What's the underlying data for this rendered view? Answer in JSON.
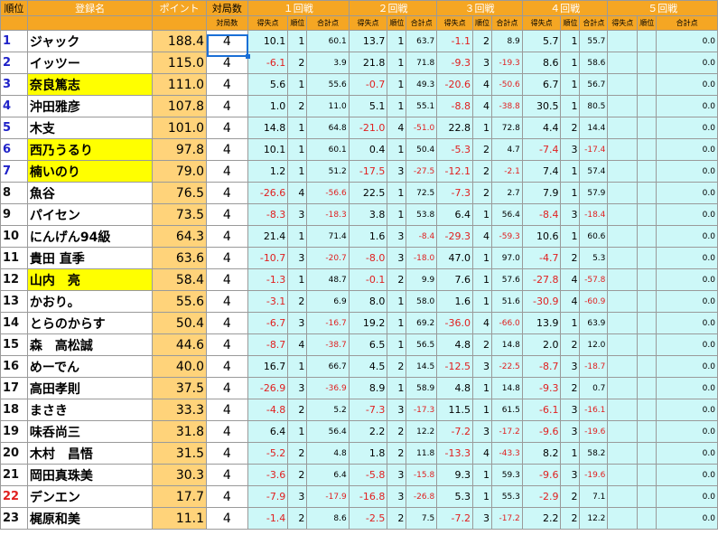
{
  "header": {
    "rank": "順位",
    "name": "登録名",
    "points": "ポイント",
    "games": "対局数",
    "games_sub": "対局数",
    "rounds": [
      "１回戦",
      "２回戦",
      "３回戦",
      "４回戦",
      "５回戦"
    ],
    "sub_score": "得失点",
    "sub_rank": "順位",
    "sub_total": "合計点"
  },
  "rows": [
    {
      "rank": "1",
      "color": "blue",
      "name": "ジャック",
      "hl": false,
      "pts": "188.4",
      "games": "4",
      "r": [
        [
          "10.1",
          "1",
          "60.1"
        ],
        [
          "13.7",
          "1",
          "63.7"
        ],
        [
          "-1.1",
          "2",
          "8.9"
        ],
        [
          "5.7",
          "1",
          "55.7"
        ],
        [
          "",
          "",
          "0.0"
        ]
      ]
    },
    {
      "rank": "2",
      "color": "blue",
      "name": "イッツー",
      "hl": false,
      "pts": "115.0",
      "games": "4",
      "r": [
        [
          "-6.1",
          "2",
          "3.9"
        ],
        [
          "21.8",
          "1",
          "71.8"
        ],
        [
          "-9.3",
          "3",
          "-19.3"
        ],
        [
          "8.6",
          "1",
          "58.6"
        ],
        [
          "",
          "",
          "0.0"
        ]
      ]
    },
    {
      "rank": "3",
      "color": "blue",
      "name": "奈良篤志",
      "hl": true,
      "pts": "111.0",
      "games": "4",
      "r": [
        [
          "5.6",
          "1",
          "55.6"
        ],
        [
          "-0.7",
          "1",
          "49.3"
        ],
        [
          "-20.6",
          "4",
          "-50.6"
        ],
        [
          "6.7",
          "1",
          "56.7"
        ],
        [
          "",
          "",
          "0.0"
        ]
      ]
    },
    {
      "rank": "4",
      "color": "blue",
      "name": "沖田雅彦",
      "hl": false,
      "pts": "107.8",
      "games": "4",
      "r": [
        [
          "1.0",
          "2",
          "11.0"
        ],
        [
          "5.1",
          "1",
          "55.1"
        ],
        [
          "-8.8",
          "4",
          "-38.8"
        ],
        [
          "30.5",
          "1",
          "80.5"
        ],
        [
          "",
          "",
          "0.0"
        ]
      ]
    },
    {
      "rank": "5",
      "color": "blue",
      "name": "木支",
      "hl": false,
      "pts": "101.0",
      "games": "4",
      "r": [
        [
          "14.8",
          "1",
          "64.8"
        ],
        [
          "-21.0",
          "4",
          "-51.0"
        ],
        [
          "22.8",
          "1",
          "72.8"
        ],
        [
          "4.4",
          "2",
          "14.4"
        ],
        [
          "",
          "",
          "0.0"
        ]
      ]
    },
    {
      "rank": "6",
      "color": "blue",
      "name": "西乃うるり",
      "hl": true,
      "pts": "97.8",
      "games": "4",
      "r": [
        [
          "10.1",
          "1",
          "60.1"
        ],
        [
          "0.4",
          "1",
          "50.4"
        ],
        [
          "-5.3",
          "2",
          "4.7"
        ],
        [
          "-7.4",
          "3",
          "-17.4"
        ],
        [
          "",
          "",
          "0.0"
        ]
      ]
    },
    {
      "rank": "7",
      "color": "blue",
      "name": "楠いのり",
      "hl": true,
      "pts": "79.0",
      "games": "4",
      "r": [
        [
          "1.2",
          "1",
          "51.2"
        ],
        [
          "-17.5",
          "3",
          "-27.5"
        ],
        [
          "-12.1",
          "2",
          "-2.1"
        ],
        [
          "7.4",
          "1",
          "57.4"
        ],
        [
          "",
          "",
          "0.0"
        ]
      ]
    },
    {
      "rank": "8",
      "color": "dark",
      "name": "魚谷",
      "hl": false,
      "pts": "76.5",
      "games": "4",
      "r": [
        [
          "-26.6",
          "4",
          "-56.6"
        ],
        [
          "22.5",
          "1",
          "72.5"
        ],
        [
          "-7.3",
          "2",
          "2.7"
        ],
        [
          "7.9",
          "1",
          "57.9"
        ],
        [
          "",
          "",
          "0.0"
        ]
      ]
    },
    {
      "rank": "9",
      "color": "dark",
      "name": "パイセン",
      "hl": false,
      "pts": "73.5",
      "games": "4",
      "r": [
        [
          "-8.3",
          "3",
          "-18.3"
        ],
        [
          "3.8",
          "1",
          "53.8"
        ],
        [
          "6.4",
          "1",
          "56.4"
        ],
        [
          "-8.4",
          "3",
          "-18.4"
        ],
        [
          "",
          "",
          "0.0"
        ]
      ]
    },
    {
      "rank": "10",
      "color": "dark",
      "name": "にんげん94級",
      "hl": false,
      "pts": "64.3",
      "games": "4",
      "r": [
        [
          "21.4",
          "1",
          "71.4"
        ],
        [
          "1.6",
          "3",
          "-8.4"
        ],
        [
          "-29.3",
          "4",
          "-59.3"
        ],
        [
          "10.6",
          "1",
          "60.6"
        ],
        [
          "",
          "",
          "0.0"
        ]
      ]
    },
    {
      "rank": "11",
      "color": "dark",
      "name": "貴田 直季",
      "hl": false,
      "pts": "63.6",
      "games": "4",
      "r": [
        [
          "-10.7",
          "3",
          "-20.7"
        ],
        [
          "-8.0",
          "3",
          "-18.0"
        ],
        [
          "47.0",
          "1",
          "97.0"
        ],
        [
          "-4.7",
          "2",
          "5.3"
        ],
        [
          "",
          "",
          "0.0"
        ]
      ]
    },
    {
      "rank": "12",
      "color": "dark",
      "name": "山内　亮",
      "hl": true,
      "pts": "58.4",
      "games": "4",
      "r": [
        [
          "-1.3",
          "1",
          "48.7"
        ],
        [
          "-0.1",
          "2",
          "9.9"
        ],
        [
          "7.6",
          "1",
          "57.6"
        ],
        [
          "-27.8",
          "4",
          "-57.8"
        ],
        [
          "",
          "",
          "0.0"
        ]
      ]
    },
    {
      "rank": "13",
      "color": "dark",
      "name": "かおり。",
      "hl": false,
      "pts": "55.6",
      "games": "4",
      "r": [
        [
          "-3.1",
          "2",
          "6.9"
        ],
        [
          "8.0",
          "1",
          "58.0"
        ],
        [
          "1.6",
          "1",
          "51.6"
        ],
        [
          "-30.9",
          "4",
          "-60.9"
        ],
        [
          "",
          "",
          "0.0"
        ]
      ]
    },
    {
      "rank": "14",
      "color": "dark",
      "name": "とらのからす",
      "hl": false,
      "pts": "50.4",
      "games": "4",
      "r": [
        [
          "-6.7",
          "3",
          "-16.7"
        ],
        [
          "19.2",
          "1",
          "69.2"
        ],
        [
          "-36.0",
          "4",
          "-66.0"
        ],
        [
          "13.9",
          "1",
          "63.9"
        ],
        [
          "",
          "",
          "0.0"
        ]
      ]
    },
    {
      "rank": "15",
      "color": "dark",
      "name": "森　高松誠",
      "hl": false,
      "pts": "44.6",
      "games": "4",
      "r": [
        [
          "-8.7",
          "4",
          "-38.7"
        ],
        [
          "6.5",
          "1",
          "56.5"
        ],
        [
          "4.8",
          "2",
          "14.8"
        ],
        [
          "2.0",
          "2",
          "12.0"
        ],
        [
          "",
          "",
          "0.0"
        ]
      ]
    },
    {
      "rank": "16",
      "color": "dark",
      "name": "めーでん",
      "hl": false,
      "pts": "40.0",
      "games": "4",
      "r": [
        [
          "16.7",
          "1",
          "66.7"
        ],
        [
          "4.5",
          "2",
          "14.5"
        ],
        [
          "-12.5",
          "3",
          "-22.5"
        ],
        [
          "-8.7",
          "3",
          "-18.7"
        ],
        [
          "",
          "",
          "0.0"
        ]
      ]
    },
    {
      "rank": "17",
      "color": "dark",
      "name": "高田孝則",
      "hl": false,
      "pts": "37.5",
      "games": "4",
      "r": [
        [
          "-26.9",
          "3",
          "-36.9"
        ],
        [
          "8.9",
          "1",
          "58.9"
        ],
        [
          "4.8",
          "1",
          "14.8"
        ],
        [
          "-9.3",
          "2",
          "0.7"
        ],
        [
          "",
          "",
          "0.0"
        ]
      ]
    },
    {
      "rank": "18",
      "color": "dark",
      "name": "まさき",
      "hl": false,
      "pts": "33.3",
      "games": "4",
      "r": [
        [
          "-4.8",
          "2",
          "5.2"
        ],
        [
          "-7.3",
          "3",
          "-17.3"
        ],
        [
          "11.5",
          "1",
          "61.5"
        ],
        [
          "-6.1",
          "3",
          "-16.1"
        ],
        [
          "",
          "",
          "0.0"
        ]
      ]
    },
    {
      "rank": "19",
      "color": "dark",
      "name": "味呑尚三",
      "hl": false,
      "pts": "31.8",
      "games": "4",
      "r": [
        [
          "6.4",
          "1",
          "56.4"
        ],
        [
          "2.2",
          "2",
          "12.2"
        ],
        [
          "-7.2",
          "3",
          "-17.2"
        ],
        [
          "-9.6",
          "3",
          "-19.6"
        ],
        [
          "",
          "",
          "0.0"
        ]
      ]
    },
    {
      "rank": "20",
      "color": "dark",
      "name": "木村　昌悟",
      "hl": false,
      "pts": "31.5",
      "games": "4",
      "r": [
        [
          "-5.2",
          "2",
          "4.8"
        ],
        [
          "1.8",
          "2",
          "11.8"
        ],
        [
          "-13.3",
          "4",
          "-43.3"
        ],
        [
          "8.2",
          "1",
          "58.2"
        ],
        [
          "",
          "",
          "0.0"
        ]
      ]
    },
    {
      "rank": "21",
      "color": "dark",
      "name": "岡田真珠美",
      "hl": false,
      "pts": "30.3",
      "games": "4",
      "r": [
        [
          "-3.6",
          "2",
          "6.4"
        ],
        [
          "-5.8",
          "3",
          "-15.8"
        ],
        [
          "9.3",
          "1",
          "59.3"
        ],
        [
          "-9.6",
          "3",
          "-19.6"
        ],
        [
          "",
          "",
          "0.0"
        ]
      ]
    },
    {
      "rank": "22",
      "color": "red",
      "name": "デンエン",
      "hl": false,
      "pts": "17.7",
      "games": "4",
      "r": [
        [
          "-7.9",
          "3",
          "-17.9"
        ],
        [
          "-16.8",
          "3",
          "-26.8"
        ],
        [
          "5.3",
          "1",
          "55.3"
        ],
        [
          "-2.9",
          "2",
          "7.1"
        ],
        [
          "",
          "",
          "0.0"
        ]
      ]
    },
    {
      "rank": "23",
      "color": "dark",
      "name": "梶原和美",
      "hl": false,
      "pts": "11.1",
      "games": "4",
      "r": [
        [
          "-1.4",
          "2",
          "8.6"
        ],
        [
          "-2.5",
          "2",
          "7.5"
        ],
        [
          "-7.2",
          "3",
          "-17.2"
        ],
        [
          "2.2",
          "2",
          "12.2"
        ],
        [
          "",
          "",
          "0.0"
        ]
      ]
    }
  ]
}
